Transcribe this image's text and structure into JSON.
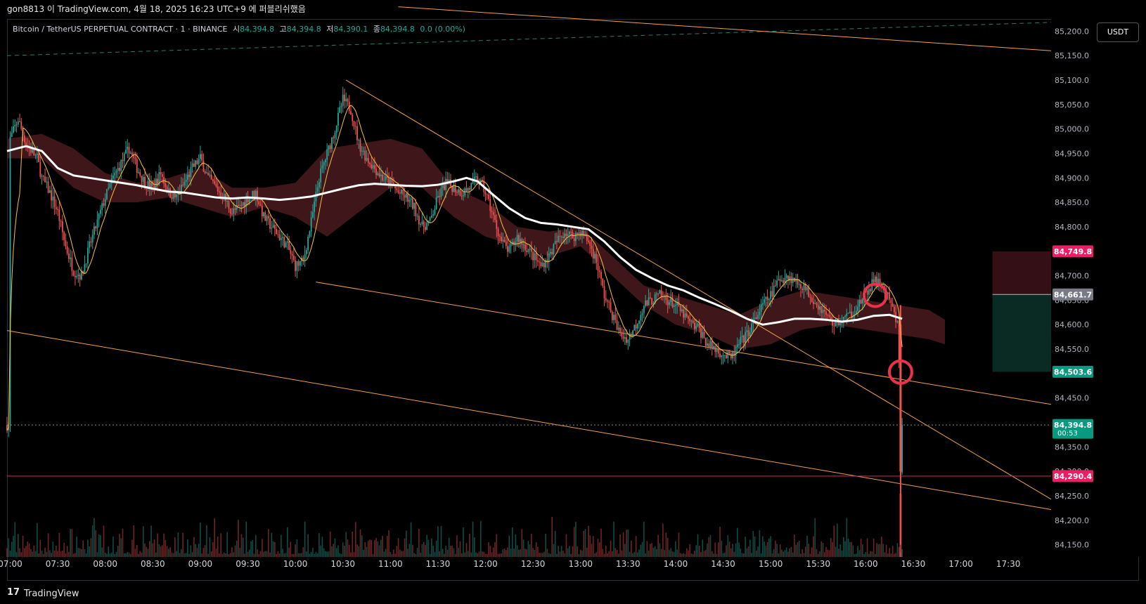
{
  "header": {
    "text": "gon8813 이 TradingView.com, 4월 18, 2025 16:23 UTC+9 에 퍼블리쉬했음"
  },
  "legend": {
    "symbol": "Bitcoin / TetherUS PERPETUAL CONTRACT · 1 · BINANCE",
    "open_label": "시",
    "open_value": "84,394.8",
    "high_label": "고",
    "high_value": "84,394.8",
    "low_label": "저",
    "low_value": "84,390.1",
    "close_label": "종",
    "close_value": "84,394.8",
    "change": "0.0 (0.00%)"
  },
  "currency_button": "USDT",
  "footer": {
    "logo": "17",
    "brand": "TradingView"
  },
  "colors": {
    "up": "#26a69a",
    "down": "#ef5350",
    "ma_fast": "#f5c242",
    "ma_slow": "#ffffff",
    "trendline": "#f0a04b",
    "cloud": "#4a1a1f",
    "support": "#e91e63",
    "marker": "#e8334a"
  },
  "chart_data": {
    "type": "candlestick",
    "symbol": "BTCUSDT.P",
    "interval": "1",
    "ylim": [
      84125,
      85225
    ],
    "y_ticks": [
      "85,200.0",
      "85,150.0",
      "85,100.0",
      "85,050.0",
      "85,000.0",
      "84,950.0",
      "84,900.0",
      "84,850.0",
      "84,800.0",
      "84,750.0",
      "84,700.0",
      "84,650.0",
      "84,600.0",
      "84,550.0",
      "84,500.0",
      "84,450.0",
      "84,400.0",
      "84,350.0",
      "84,300.0",
      "84,250.0",
      "84,200.0",
      "84,150.0"
    ],
    "y_tick_values": [
      85200,
      85150,
      85100,
      85050,
      85000,
      84950,
      84900,
      84850,
      84800,
      84750,
      84700,
      84650,
      84600,
      84550,
      84500,
      84450,
      84400,
      84350,
      84300,
      84250,
      84200,
      84150
    ],
    "x_ticks": [
      "07:00",
      "07:30",
      "08:00",
      "08:30",
      "09:00",
      "09:30",
      "10:00",
      "10:30",
      "11:00",
      "11:30",
      "12:00",
      "12:30",
      "13:00",
      "13:30",
      "14:00",
      "14:30",
      "15:00",
      "15:30",
      "16:00",
      "16:30",
      "17:00",
      "17:30"
    ],
    "x_tick_minutes": [
      420,
      450,
      480,
      510,
      540,
      570,
      600,
      630,
      660,
      690,
      720,
      750,
      780,
      810,
      840,
      870,
      900,
      930,
      960,
      990,
      1020,
      1050
    ],
    "x_range_minutes": [
      418,
      1077
    ],
    "last_candle_minute": 983,
    "price_path": [
      [
        420,
        84980
      ],
      [
        425,
        85020
      ],
      [
        430,
        84970
      ],
      [
        437,
        84940
      ],
      [
        440,
        84900
      ],
      [
        445,
        84870
      ],
      [
        450,
        84830
      ],
      [
        455,
        84760
      ],
      [
        460,
        84710
      ],
      [
        465,
        84700
      ],
      [
        470,
        84760
      ],
      [
        475,
        84810
      ],
      [
        480,
        84860
      ],
      [
        485,
        84900
      ],
      [
        490,
        84930
      ],
      [
        495,
        84960
      ],
      [
        500,
        84920
      ],
      [
        505,
        84890
      ],
      [
        510,
        84880
      ],
      [
        515,
        84910
      ],
      [
        520,
        84870
      ],
      [
        525,
        84860
      ],
      [
        530,
        84890
      ],
      [
        535,
        84920
      ],
      [
        540,
        84940
      ],
      [
        545,
        84900
      ],
      [
        550,
        84880
      ],
      [
        555,
        84860
      ],
      [
        560,
        84830
      ],
      [
        565,
        84840
      ],
      [
        570,
        84860
      ],
      [
        575,
        84870
      ],
      [
        580,
        84820
      ],
      [
        585,
        84800
      ],
      [
        590,
        84780
      ],
      [
        595,
        84760
      ],
      [
        600,
        84720
      ],
      [
        605,
        84730
      ],
      [
        610,
        84810
      ],
      [
        615,
        84900
      ],
      [
        620,
        84950
      ],
      [
        625,
        85000
      ],
      [
        630,
        85060
      ],
      [
        635,
        85040
      ],
      [
        640,
        84970
      ],
      [
        645,
        84940
      ],
      [
        650,
        84920
      ],
      [
        655,
        84900
      ],
      [
        660,
        84890
      ],
      [
        665,
        84870
      ],
      [
        670,
        84860
      ],
      [
        675,
        84840
      ],
      [
        680,
        84800
      ],
      [
        685,
        84810
      ],
      [
        690,
        84860
      ],
      [
        695,
        84890
      ],
      [
        700,
        84880
      ],
      [
        705,
        84870
      ],
      [
        710,
        84880
      ],
      [
        715,
        84900
      ],
      [
        720,
        84870
      ],
      [
        725,
        84820
      ],
      [
        730,
        84770
      ],
      [
        735,
        84750
      ],
      [
        740,
        84780
      ],
      [
        745,
        84760
      ],
      [
        750,
        84740
      ],
      [
        755,
        84720
      ],
      [
        760,
        84740
      ],
      [
        765,
        84770
      ],
      [
        770,
        84790
      ],
      [
        775,
        84780
      ],
      [
        780,
        84790
      ],
      [
        785,
        84770
      ],
      [
        790,
        84730
      ],
      [
        795,
        84660
      ],
      [
        800,
        84620
      ],
      [
        805,
        84580
      ],
      [
        810,
        84570
      ],
      [
        815,
        84600
      ],
      [
        820,
        84640
      ],
      [
        825,
        84650
      ],
      [
        830,
        84660
      ],
      [
        835,
        84650
      ],
      [
        840,
        84640
      ],
      [
        845,
        84620
      ],
      [
        850,
        84600
      ],
      [
        855,
        84590
      ],
      [
        860,
        84560
      ],
      [
        865,
        84550
      ],
      [
        870,
        84540
      ],
      [
        875,
        84530
      ],
      [
        880,
        84560
      ],
      [
        885,
        84580
      ],
      [
        890,
        84610
      ],
      [
        895,
        84640
      ],
      [
        900,
        84660
      ],
      [
        905,
        84690
      ],
      [
        910,
        84700
      ],
      [
        915,
        84690
      ],
      [
        920,
        84680
      ],
      [
        925,
        84660
      ],
      [
        930,
        84640
      ],
      [
        935,
        84620
      ],
      [
        940,
        84600
      ],
      [
        945,
        84610
      ],
      [
        950,
        84620
      ],
      [
        955,
        84640
      ],
      [
        960,
        84660
      ],
      [
        965,
        84690
      ],
      [
        970,
        84680
      ],
      [
        975,
        84650
      ],
      [
        978,
        84620
      ],
      [
        980,
        84600
      ],
      [
        981,
        84520
      ],
      [
        982,
        84300
      ],
      [
        983,
        84394.8
      ]
    ],
    "sma_slow_path": [
      [
        418,
        84955
      ],
      [
        430,
        84965
      ],
      [
        440,
        84955
      ],
      [
        450,
        84920
      ],
      [
        460,
        84905
      ],
      [
        470,
        84900
      ],
      [
        480,
        84895
      ],
      [
        490,
        84890
      ],
      [
        500,
        84885
      ],
      [
        510,
        84878
      ],
      [
        520,
        84872
      ],
      [
        530,
        84870
      ],
      [
        540,
        84865
      ],
      [
        550,
        84860
      ],
      [
        560,
        84858
      ],
      [
        570,
        84860
      ],
      [
        580,
        84858
      ],
      [
        590,
        84855
      ],
      [
        600,
        84858
      ],
      [
        610,
        84862
      ],
      [
        620,
        84870
      ],
      [
        630,
        84878
      ],
      [
        640,
        84885
      ],
      [
        650,
        84888
      ],
      [
        660,
        84886
      ],
      [
        670,
        84884
      ],
      [
        680,
        84883
      ],
      [
        690,
        84886
      ],
      [
        700,
        84893
      ],
      [
        708,
        84900
      ],
      [
        715,
        84893
      ],
      [
        725,
        84865
      ],
      [
        735,
        84838
      ],
      [
        745,
        84818
      ],
      [
        755,
        84808
      ],
      [
        765,
        84805
      ],
      [
        775,
        84800
      ],
      [
        785,
        84795
      ],
      [
        795,
        84770
      ],
      [
        805,
        84738
      ],
      [
        815,
        84712
      ],
      [
        825,
        84695
      ],
      [
        835,
        84680
      ],
      [
        845,
        84670
      ],
      [
        855,
        84655
      ],
      [
        865,
        84642
      ],
      [
        875,
        84628
      ],
      [
        885,
        84612
      ],
      [
        895,
        84600
      ],
      [
        905,
        84605
      ],
      [
        915,
        84612
      ],
      [
        925,
        84612
      ],
      [
        935,
        84610
      ],
      [
        945,
        84606
      ],
      [
        955,
        84610
      ],
      [
        965,
        84618
      ],
      [
        975,
        84620
      ],
      [
        983,
        84612
      ]
    ],
    "cloud_top_path": [
      [
        418,
        84980
      ],
      [
        440,
        84990
      ],
      [
        460,
        84960
      ],
      [
        480,
        84910
      ],
      [
        500,
        84890
      ],
      [
        520,
        84900
      ],
      [
        540,
        84920
      ],
      [
        560,
        84880
      ],
      [
        580,
        84880
      ],
      [
        600,
        84890
      ],
      [
        620,
        84960
      ],
      [
        640,
        84970
      ],
      [
        660,
        84980
      ],
      [
        680,
        84960
      ],
      [
        700,
        84880
      ],
      [
        720,
        84850
      ],
      [
        740,
        84800
      ],
      [
        760,
        84790
      ],
      [
        780,
        84800
      ],
      [
        800,
        84740
      ],
      [
        820,
        84680
      ],
      [
        840,
        84660
      ],
      [
        860,
        84640
      ],
      [
        880,
        84620
      ],
      [
        900,
        84650
      ],
      [
        920,
        84670
      ],
      [
        940,
        84660
      ],
      [
        960,
        84650
      ],
      [
        980,
        84640
      ],
      [
        1000,
        84630
      ],
      [
        1010,
        84610
      ]
    ],
    "cloud_bottom_path": [
      [
        418,
        84940
      ],
      [
        440,
        84940
      ],
      [
        460,
        84880
      ],
      [
        480,
        84850
      ],
      [
        500,
        84850
      ],
      [
        520,
        84860
      ],
      [
        540,
        84840
      ],
      [
        560,
        84820
      ],
      [
        580,
        84840
      ],
      [
        600,
        84820
      ],
      [
        620,
        84780
      ],
      [
        640,
        84830
      ],
      [
        660,
        84880
      ],
      [
        680,
        84880
      ],
      [
        700,
        84820
      ],
      [
        720,
        84780
      ],
      [
        740,
        84760
      ],
      [
        760,
        84740
      ],
      [
        780,
        84760
      ],
      [
        800,
        84700
      ],
      [
        820,
        84640
      ],
      [
        840,
        84600
      ],
      [
        860,
        84580
      ],
      [
        880,
        84550
      ],
      [
        900,
        84560
      ],
      [
        920,
        84590
      ],
      [
        940,
        84600
      ],
      [
        960,
        84590
      ],
      [
        980,
        84580
      ],
      [
        1000,
        84570
      ],
      [
        1010,
        84560
      ]
    ],
    "trendlines": [
      {
        "name": "channel-top-outer",
        "points": [
          [
            665,
            85250
          ],
          [
            1077,
            85160
          ]
        ]
      },
      {
        "name": "descending-resistance",
        "points": [
          [
            632,
            85100
          ],
          [
            1077,
            84243
          ]
        ]
      },
      {
        "name": "channel-lower",
        "points": [
          [
            613,
            84687
          ],
          [
            1077,
            84437
          ]
        ]
      },
      {
        "name": "channel-bottom-outer",
        "points": [
          [
            418,
            84588
          ],
          [
            1077,
            84222
          ]
        ]
      }
    ],
    "dashed_upper_line": [
      [
        418,
        85150
      ],
      [
        1077,
        85218
      ]
    ],
    "support_line": 84290.4,
    "current_price_line": 84394.8,
    "markers": [
      [
        966,
        84660
      ],
      [
        982,
        84503
      ]
    ],
    "position_box": {
      "x_minutes": [
        1040,
        1077
      ],
      "entry": 84661.7,
      "stop": 84749.8,
      "target": 84503.6
    },
    "price_labels": [
      {
        "value": "84,749.8",
        "price": 84749.8,
        "color": "#e91e63"
      },
      {
        "value": "84,661.7",
        "price": 84661.7,
        "color": "#787b86"
      },
      {
        "value": "84,503.6",
        "price": 84503.6,
        "color": "#089981"
      },
      {
        "value": "84,394.8",
        "price": 84394.8,
        "color": "#089981",
        "sub": "00:53"
      },
      {
        "value": "84,290.4",
        "price": 84290.4,
        "color": "#e91e63"
      }
    ]
  }
}
